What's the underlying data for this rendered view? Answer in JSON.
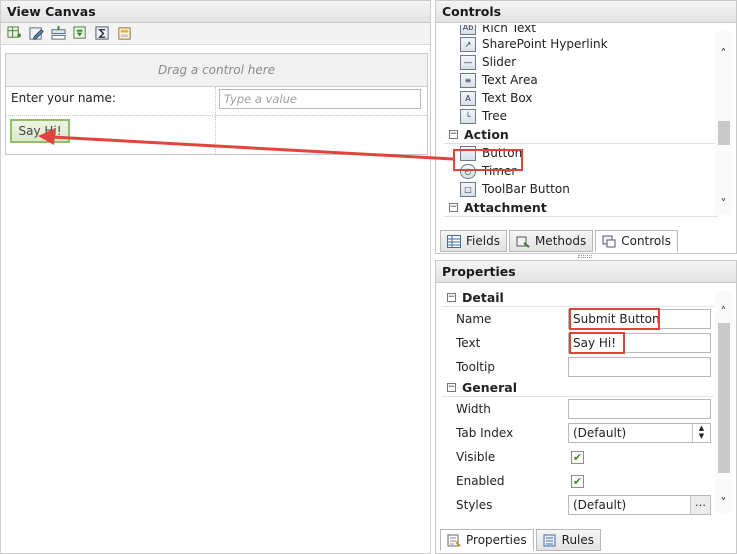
{
  "view_canvas": {
    "title": "View Canvas",
    "toolbar_icons": [
      "add-row-icon",
      "edit-form-icon",
      "insert-row-icon",
      "rule-icon",
      "sigma-icon",
      "layout-icon"
    ],
    "drop_hint": "Drag a control here",
    "name_label": "Enter your name:",
    "name_placeholder": "Type a value",
    "button_label": "Say Hi!"
  },
  "controls": {
    "title": "Controls",
    "items_top": [
      {
        "label": "Rich Text",
        "icon": "rich-text-icon"
      },
      {
        "label": "SharePoint Hyperlink",
        "icon": "hyperlink-icon"
      },
      {
        "label": "Slider",
        "icon": "slider-icon"
      },
      {
        "label": "Text Area",
        "icon": "text-area-icon"
      },
      {
        "label": "Text Box",
        "icon": "text-box-icon"
      },
      {
        "label": "Tree",
        "icon": "tree-icon"
      }
    ],
    "category_action": "Action",
    "items_action": [
      {
        "label": "Button",
        "icon": "button-icon"
      },
      {
        "label": "Timer",
        "icon": "timer-icon"
      },
      {
        "label": "ToolBar Button",
        "icon": "toolbar-button-icon"
      }
    ],
    "category_attachment": "Attachment",
    "tabs": [
      {
        "label": "Fields",
        "icon": "fields-icon"
      },
      {
        "label": "Methods",
        "icon": "methods-icon"
      },
      {
        "label": "Controls",
        "icon": "controls-icon"
      }
    ],
    "active_tab": "Controls"
  },
  "properties": {
    "title": "Properties",
    "category_detail": "Detail",
    "name_label": "Name",
    "name_value": "Submit Button",
    "text_label": "Text",
    "text_value": "Say Hi!",
    "tooltip_label": "Tooltip",
    "tooltip_value": "",
    "category_general": "General",
    "width_label": "Width",
    "width_value": "",
    "tabindex_label": "Tab Index",
    "tabindex_value": "(Default)",
    "visible_label": "Visible",
    "visible_checked": true,
    "enabled_label": "Enabled",
    "enabled_checked": true,
    "styles_label": "Styles",
    "styles_value": "(Default)",
    "tabs": [
      {
        "label": "Properties",
        "icon": "properties-icon"
      },
      {
        "label": "Rules",
        "icon": "rules-icon"
      }
    ],
    "active_tab": "Properties"
  },
  "colors": {
    "highlight": "#e0453d",
    "accent_green": "#8fc06a"
  }
}
